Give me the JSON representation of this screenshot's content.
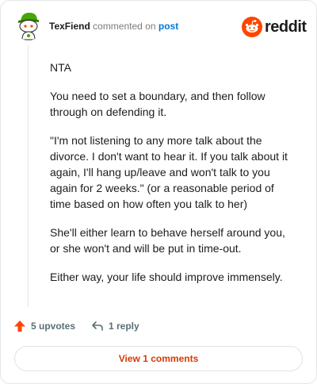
{
  "header": {
    "username": "TexFiend",
    "action_text": "commented on",
    "post_link": "post",
    "brand": "reddit"
  },
  "comment": {
    "paragraphs": [
      "NTA",
      "You need to set a boundary, and then follow through on defending it.",
      "\"I'm not listening to any more talk about the divorce. I don't want to hear it. If you talk about it again, I'll hang up/leave and won't talk to you again for 2 weeks.\" (or a reasonable period of time based on how often you talk to her)",
      "She'll either learn to behave herself around you, or she won't and will be put in time-out.",
      "Either way, your life should improve immensely."
    ]
  },
  "actions": {
    "upvotes_label": "5 upvotes",
    "reply_label": "1 reply"
  },
  "footer": {
    "view_label": "View 1 comments"
  },
  "colors": {
    "brand_orange": "#ff4500",
    "link_blue": "#0079d3",
    "upvote_orange": "#ff4500",
    "view_text": "#d93900"
  },
  "icons": {
    "avatar": "snoo-avatar-icon",
    "logo": "reddit-logo-icon",
    "upvote": "upvote-arrow-icon",
    "reply": "reply-arrow-icon"
  }
}
